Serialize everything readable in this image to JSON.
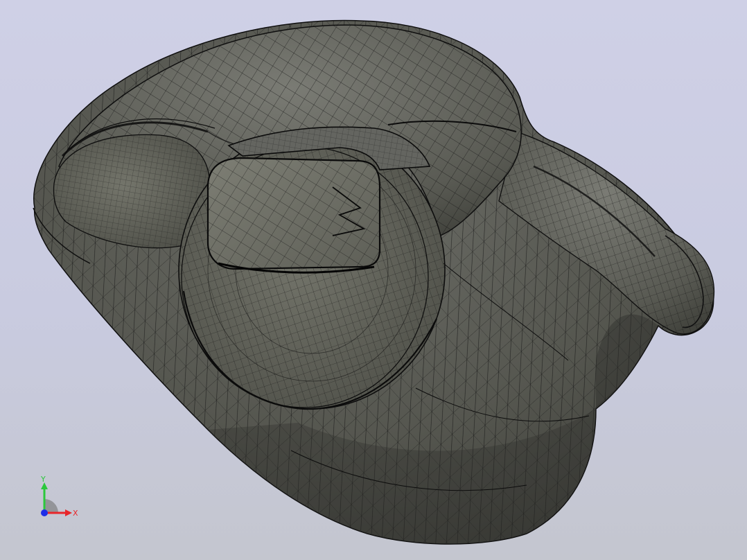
{
  "viewer": {
    "background_top": "#cfd0e6",
    "background_bottom": "#c4c6cf",
    "model": {
      "display_mode": "shaded-with-edges",
      "surface_color": "#5c5d57",
      "edge_color": "#111111"
    },
    "axis_triad": {
      "x_label": "X",
      "y_label": "Y",
      "x_color": "#e8262a",
      "y_color": "#2bc83c",
      "z_color": "#1e2ee8"
    }
  }
}
